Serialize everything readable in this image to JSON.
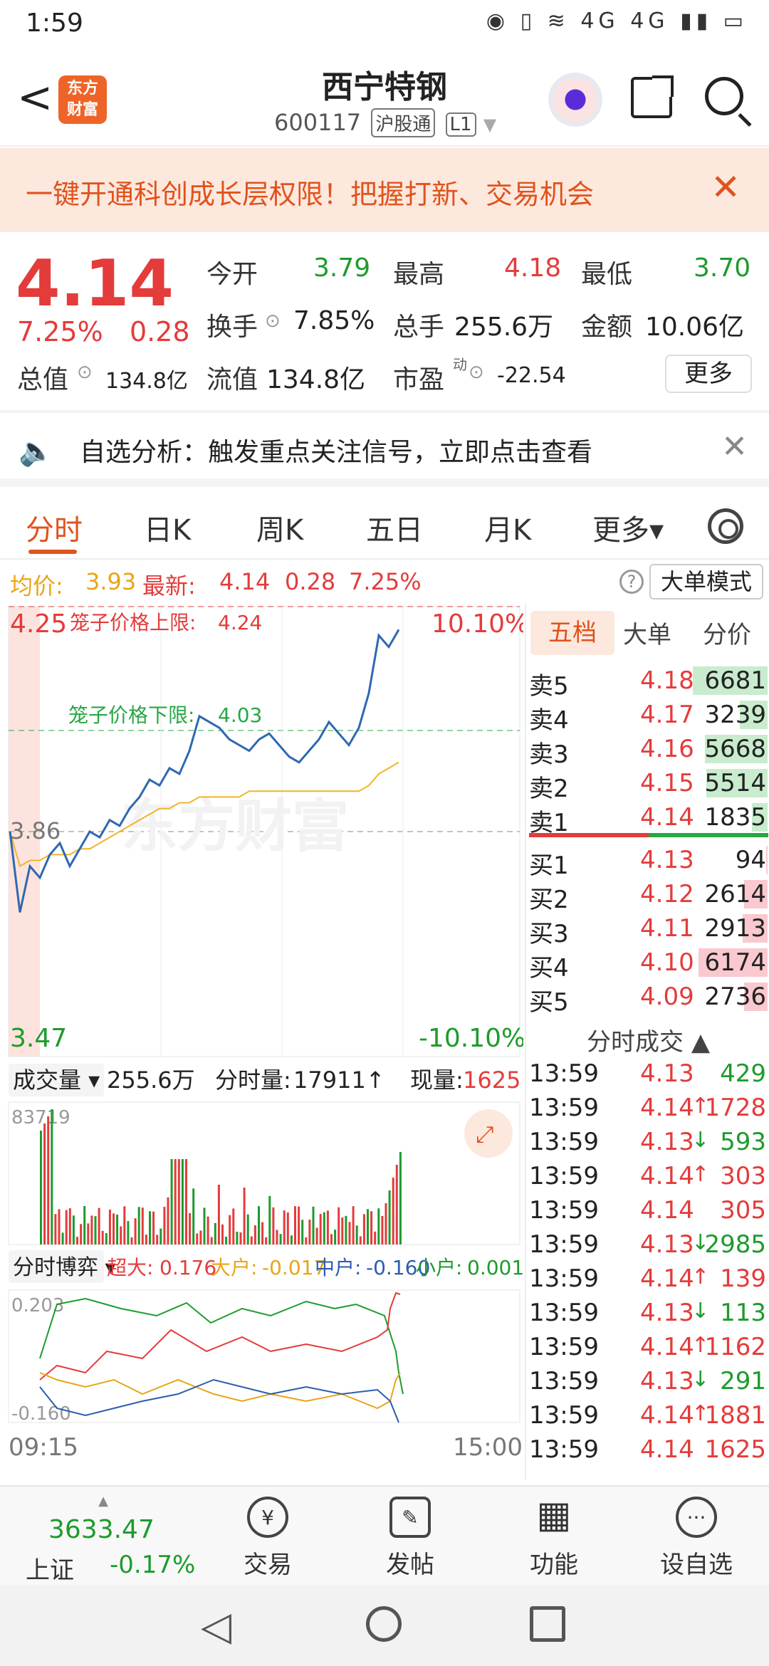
{
  "status_bar": {
    "time": "1:59",
    "network": "4G 4G"
  },
  "header": {
    "back": "<",
    "logo_line1": "东方",
    "logo_line2": "财富",
    "stock_name": "西宁特钢",
    "stock_code": "600117",
    "tag1": "沪股通",
    "tag2": "L1"
  },
  "promo": {
    "text": "一键开通科创成长层权限！把握打新、交易机会",
    "close": "✕"
  },
  "quote": {
    "price": "4.14",
    "change_pct": "7.25%",
    "change_amt": "0.28",
    "open_label": "今开",
    "open": "3.79",
    "high_label": "最高",
    "high": "4.18",
    "low_label": "最低",
    "low": "3.70",
    "turnover_label": "换手",
    "turnover": "7.85%",
    "volume_label": "总手",
    "volume": "255.6万",
    "amount_label": "金额",
    "amount": "10.06亿",
    "mktcap_label": "总值",
    "mktcap": "134.8亿",
    "float_label": "流值",
    "float": "134.8亿",
    "pe_label": "市盈",
    "pe_sup": "动",
    "pe": "-22.54",
    "more": "更多"
  },
  "notice": {
    "text": "自选分析：触发重点关注信号，立即点击查看",
    "close": "✕"
  },
  "tabs": [
    "分时",
    "日K",
    "周K",
    "五日",
    "月K",
    "更多▾"
  ],
  "infoline": {
    "avg_label": "均价:",
    "avg": "3.93",
    "latest_label": "最新:",
    "latest": "4.14",
    "chg": "0.28",
    "pct": "7.25%",
    "big_order_mode": "大单模式",
    "help": "?"
  },
  "chart": {
    "price_top": "4.25",
    "price_bottom": "3.47",
    "pct_top": "10.10%",
    "pct_bottom": "-10.10%",
    "prev_close": "3.86",
    "upper_limit_label": "笼子价格上限:",
    "upper_limit": "4.24",
    "lower_limit_label": "笼子价格下限:",
    "lower_limit": "4.03",
    "watermark": "东方财富",
    "vol_selector": "成交量 ▾",
    "vol_total": "255.6万",
    "vol_minute_label": "分时量:",
    "vol_minute": "17911↑",
    "vol_now_label": "现量:",
    "vol_now": "1625",
    "vol_max": "83719",
    "flow_selector": "分时博弈 ▾",
    "flow_super_label": "超大:",
    "flow_super": "0.176",
    "flow_big_label": "大户:",
    "flow_big": "-0.017",
    "flow_mid_label": "中户:",
    "flow_mid": "-0.160",
    "flow_small_label": "小户:",
    "flow_small": "0.001",
    "flow_top": "0.203",
    "flow_bottom": "-0.160",
    "time_start": "09:15",
    "time_end": "15:00"
  },
  "chart_data": {
    "type": "line",
    "x_range": [
      "09:15",
      "15:00"
    ],
    "ylim": [
      3.47,
      4.25
    ],
    "series": [
      {
        "name": "最新",
        "values": [
          3.86,
          3.72,
          3.8,
          3.78,
          3.82,
          3.84,
          3.8,
          3.83,
          3.86,
          3.85,
          3.88,
          3.87,
          3.9,
          3.92,
          3.95,
          3.94,
          3.97,
          3.96,
          4.0,
          4.06,
          4.05,
          4.04,
          4.02,
          4.01,
          4.0,
          4.02,
          4.03,
          4.01,
          3.99,
          3.98,
          4.0,
          4.02,
          4.05,
          4.03,
          4.01,
          4.04,
          4.1,
          4.2,
          4.18,
          4.21
        ]
      },
      {
        "name": "均价",
        "values": [
          3.86,
          3.8,
          3.81,
          3.81,
          3.82,
          3.82,
          3.82,
          3.83,
          3.83,
          3.84,
          3.85,
          3.86,
          3.87,
          3.88,
          3.89,
          3.9,
          3.9,
          3.91,
          3.91,
          3.92,
          3.92,
          3.92,
          3.92,
          3.92,
          3.93,
          3.93,
          3.93,
          3.93,
          3.93,
          3.93,
          3.93,
          3.93,
          3.93,
          3.93,
          3.93,
          3.93,
          3.94,
          3.96,
          3.97,
          3.98
        ]
      }
    ]
  },
  "orderbook": {
    "tabs": [
      "五档",
      "大单",
      "分价"
    ],
    "asks": [
      {
        "label": "卖5",
        "price": "4.18",
        "vol": "6681",
        "fill": 0.95
      },
      {
        "label": "卖4",
        "price": "4.17",
        "vol": "3239",
        "fill": 0.35
      },
      {
        "label": "卖3",
        "price": "4.16",
        "vol": "5668",
        "fill": 0.8
      },
      {
        "label": "卖2",
        "price": "4.15",
        "vol": "5514",
        "fill": 0.78
      },
      {
        "label": "卖1",
        "price": "4.14",
        "vol": "1835",
        "fill": 0.2
      }
    ],
    "bids": [
      {
        "label": "买1",
        "price": "4.13",
        "vol": "94",
        "fill": 0.02
      },
      {
        "label": "买2",
        "price": "4.12",
        "vol": "2614",
        "fill": 0.3
      },
      {
        "label": "买3",
        "price": "4.11",
        "vol": "2913",
        "fill": 0.32
      },
      {
        "label": "买4",
        "price": "4.10",
        "vol": "6174",
        "fill": 0.88
      },
      {
        "label": "买5",
        "price": "4.09",
        "vol": "2736",
        "fill": 0.3
      }
    ],
    "trades_header": "分时成交 ▲",
    "trades": [
      {
        "time": "13:59",
        "price": "4.13",
        "dir": "",
        "vol": "429",
        "color": "green"
      },
      {
        "time": "13:59",
        "price": "4.14",
        "dir": "↑",
        "vol": "1728",
        "color": "red"
      },
      {
        "time": "13:59",
        "price": "4.13",
        "dir": "↓",
        "vol": "593",
        "color": "green"
      },
      {
        "time": "13:59",
        "price": "4.14",
        "dir": "↑",
        "vol": "303",
        "color": "red"
      },
      {
        "time": "13:59",
        "price": "4.14",
        "dir": "",
        "vol": "305",
        "color": "red"
      },
      {
        "time": "13:59",
        "price": "4.13",
        "dir": "↓",
        "vol": "2985",
        "color": "green"
      },
      {
        "time": "13:59",
        "price": "4.14",
        "dir": "↑",
        "vol": "139",
        "color": "red"
      },
      {
        "time": "13:59",
        "price": "4.13",
        "dir": "↓",
        "vol": "113",
        "color": "green"
      },
      {
        "time": "13:59",
        "price": "4.14",
        "dir": "↑",
        "vol": "1162",
        "color": "red"
      },
      {
        "time": "13:59",
        "price": "4.13",
        "dir": "↓",
        "vol": "291",
        "color": "green"
      },
      {
        "time": "13:59",
        "price": "4.14",
        "dir": "↑",
        "vol": "1881",
        "color": "red"
      },
      {
        "time": "13:59",
        "price": "4.14",
        "dir": "",
        "vol": "1625",
        "color": "red"
      }
    ]
  },
  "bottom_nav": {
    "index_value": "3633.47",
    "index_name": "上证",
    "index_pct": "-0.17%",
    "items": [
      {
        "label": "交易",
        "icon": "¥"
      },
      {
        "label": "发帖",
        "icon": "✎"
      },
      {
        "label": "功能",
        "icon": "▦"
      },
      {
        "label": "设自选",
        "icon": "···"
      }
    ]
  },
  "colors": {
    "up": "#e43b3b",
    "down": "#1d9b2c",
    "accent": "#e0531c",
    "avg_line": "#f0b429",
    "price_line": "#2f68b0"
  }
}
